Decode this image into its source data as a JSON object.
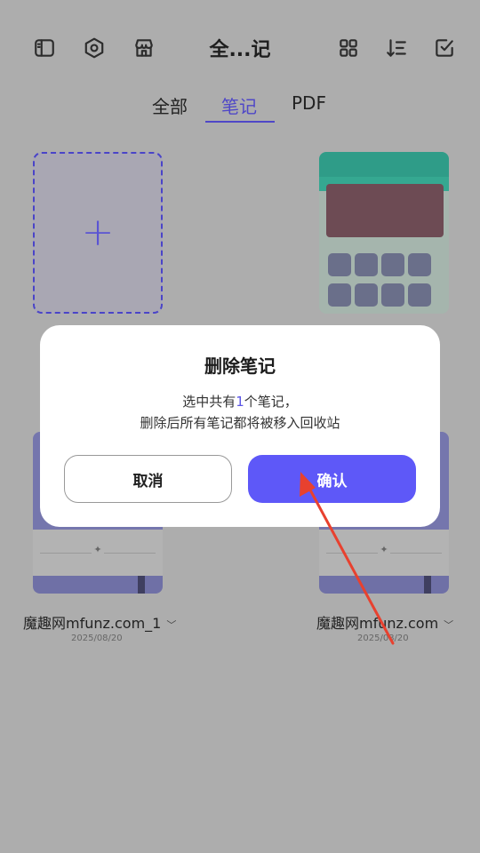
{
  "header": {
    "title": "全...记"
  },
  "tabs": [
    {
      "label": "全部"
    },
    {
      "label": "笔记"
    },
    {
      "label": "PDF"
    }
  ],
  "add_card": {
    "symbol": "+"
  },
  "notebooks": [
    {
      "title": "魔趣网mfunz.com_1",
      "date": "2025/08/20"
    },
    {
      "title": "魔趣网mfunz.com",
      "date": "2025/08/20"
    }
  ],
  "dialog": {
    "title": "删除笔记",
    "line1_prefix": "选中共有",
    "line1_count": "1",
    "line1_suffix": "个笔记，",
    "line2": "删除后所有笔记都将被移入回收站",
    "cancel_label": "取消",
    "confirm_label": "确认"
  },
  "colors": {
    "accent": "#5e58f8",
    "annotation_arrow": "#e8412f"
  }
}
